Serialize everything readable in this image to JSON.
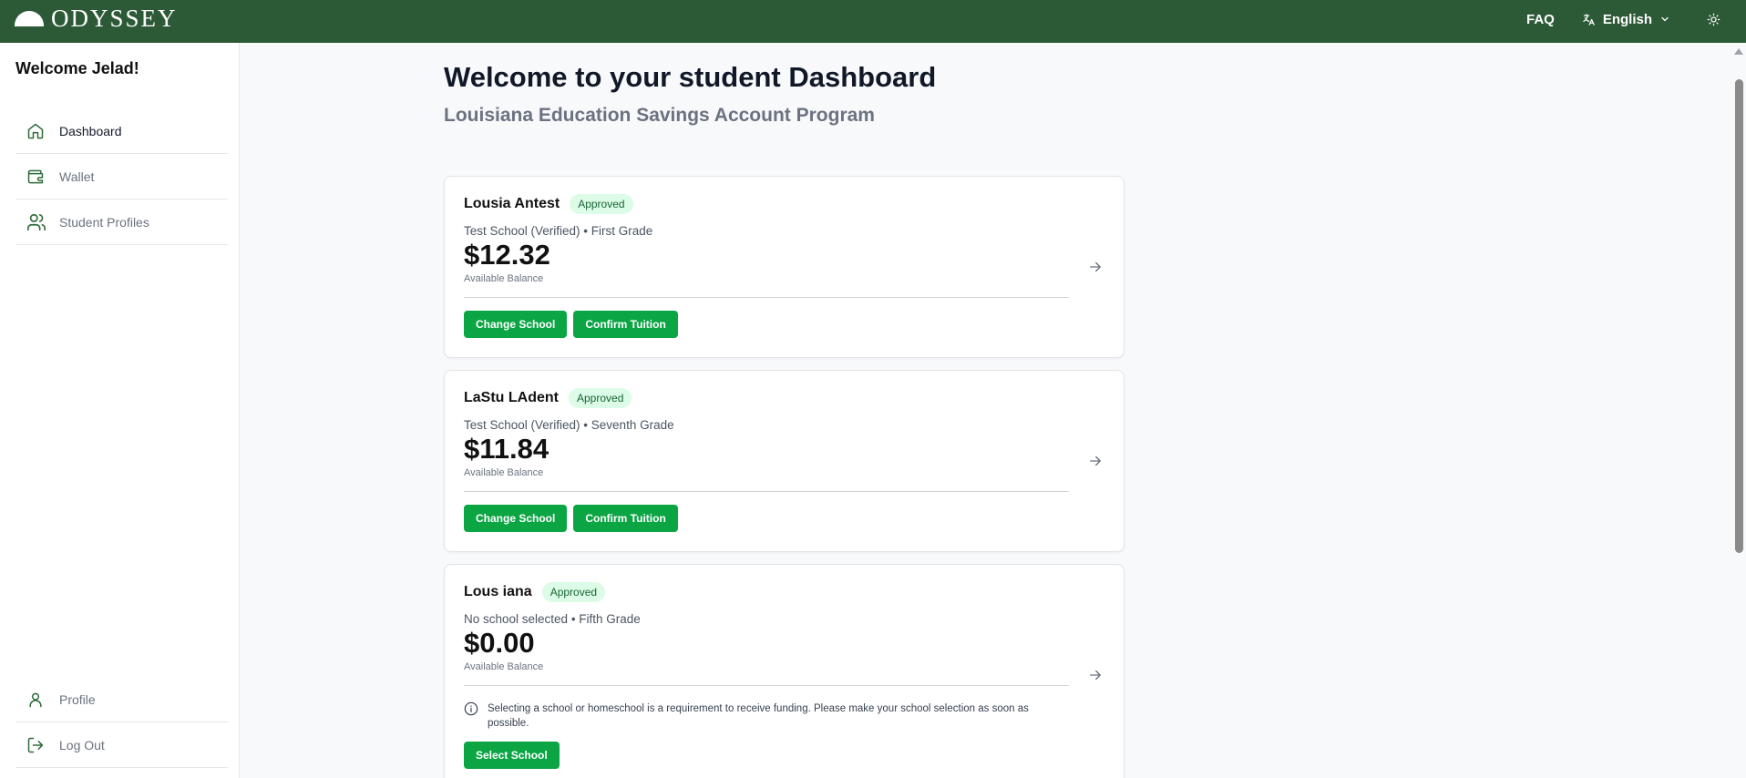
{
  "header": {
    "logo_text": "ODYSSEY",
    "faq_label": "FAQ",
    "language_label": "English",
    "brand_color": "#2d5a36"
  },
  "sidebar": {
    "welcome": "Welcome Jelad!",
    "items": [
      {
        "label": "Dashboard",
        "icon": "home-icon"
      },
      {
        "label": "Wallet",
        "icon": "wallet-icon"
      },
      {
        "label": "Student Profiles",
        "icon": "users-icon"
      }
    ],
    "bottom_items": [
      {
        "label": "Profile",
        "icon": "user-icon"
      },
      {
        "label": "Log Out",
        "icon": "logout-icon"
      }
    ]
  },
  "main": {
    "title": "Welcome to your student Dashboard",
    "subtitle": "Louisiana Education Savings Account Program"
  },
  "students": [
    {
      "name": "Lousia Antest",
      "status": "Approved",
      "school_grade": "Test School (Verified) • First Grade",
      "balance": "$12.32",
      "balance_label": "Available Balance",
      "buttons": [
        "Change School",
        "Confirm Tuition"
      ]
    },
    {
      "name": "LaStu LAdent",
      "status": "Approved",
      "school_grade": "Test School (Verified) • Seventh Grade",
      "balance": "$11.84",
      "balance_label": "Available Balance",
      "buttons": [
        "Change School",
        "Confirm Tuition"
      ]
    },
    {
      "name": "Lous iana",
      "status": "Approved",
      "school_grade": "No school selected • Fifth Grade",
      "balance": "$0.00",
      "balance_label": "Available Balance",
      "notice": "Selecting a school or homeschool is a requirement to receive funding. Please make your school selection as soon as possible.",
      "buttons": [
        "Select School"
      ]
    }
  ],
  "colors": {
    "accent": "#0ba544",
    "badge_bg": "#dcfce7",
    "badge_text": "#166534"
  }
}
